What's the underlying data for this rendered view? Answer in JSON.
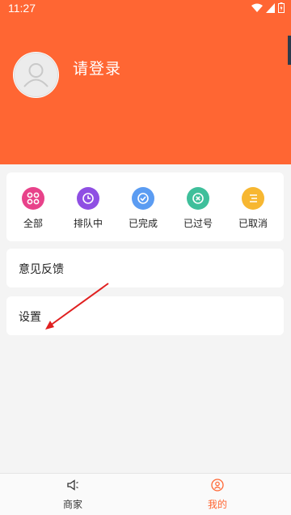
{
  "status_bar": {
    "time": "11:27"
  },
  "profile": {
    "login_prompt": "请登录"
  },
  "orders": [
    {
      "label": "全部",
      "color": "#e8428a",
      "icon": "grid-icon"
    },
    {
      "label": "排队中",
      "color": "#8f4fe3",
      "icon": "clock-icon"
    },
    {
      "label": "已完成",
      "color": "#5b9cf2",
      "icon": "check-circle-icon"
    },
    {
      "label": "已过号",
      "color": "#3fbf9b",
      "icon": "x-circle-icon"
    },
    {
      "label": "已取消",
      "color": "#f7b731",
      "icon": "list-icon"
    }
  ],
  "menu": {
    "feedback": "意见反馈",
    "settings": "设置"
  },
  "tabs": [
    {
      "label": "商家",
      "icon": "speaker-icon",
      "color": "#333333"
    },
    {
      "label": "我的",
      "icon": "user-circle-icon",
      "color": "#ff6633"
    }
  ],
  "colors": {
    "brand": "#ff6633",
    "annotation_arrow": "#e02020"
  }
}
